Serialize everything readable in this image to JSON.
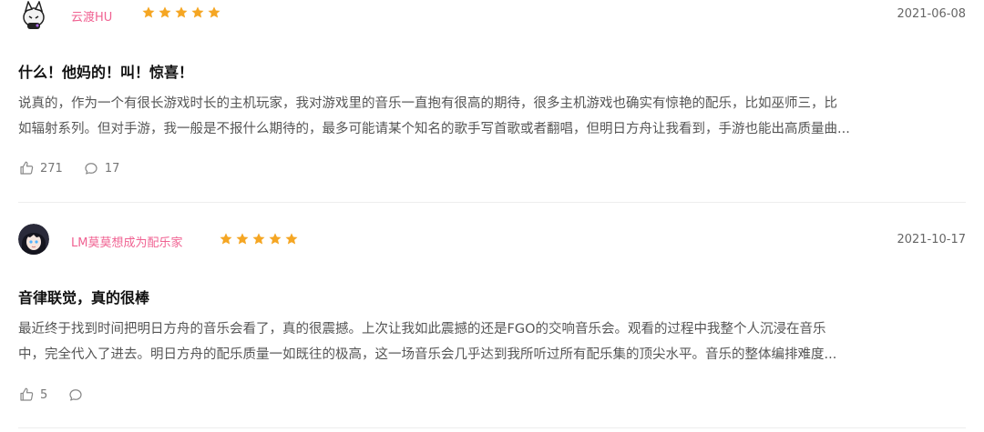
{
  "colors": {
    "accent_pink": "#f06292",
    "star_orange": "#f5a623",
    "text": "#555555",
    "title": "#111111"
  },
  "reviews": [
    {
      "username": "云渡HU",
      "rating": 5,
      "date": "2021-06-08",
      "title": "什么！他妈的！叫！惊喜！",
      "body_line1": "说真的，作为一个有很长游戏时长的主机玩家，我对游戏里的音乐一直抱有很高的期待，很多主机游戏也确实有惊艳的配乐，比如巫师三，比",
      "body_line2": "如辐射系列。但对手游，我一般是不报什么期待的，最多可能请某个知名的歌手写首歌或者翻唱，但明日方舟让我看到，手游也能出高质量曲...",
      "likes": "271",
      "comments": "17"
    },
    {
      "username": "LM莫莫想成为配乐家",
      "rating": 5,
      "date": "2021-10-17",
      "title": "音律联觉，真的很棒",
      "body_line1": "最近终于找到时间把明日方舟的音乐会看了，真的很震撼。上次让我如此震撼的还是FGO的交响音乐会。观看的过程中我整个人沉浸在音乐",
      "body_line2": "中，完全代入了进去。明日方舟的配乐质量一如既往的极高，这一场音乐会几乎达到我所听过所有配乐集的顶尖水平。音乐的整体编排难度...",
      "likes": "5",
      "comments": ""
    }
  ]
}
